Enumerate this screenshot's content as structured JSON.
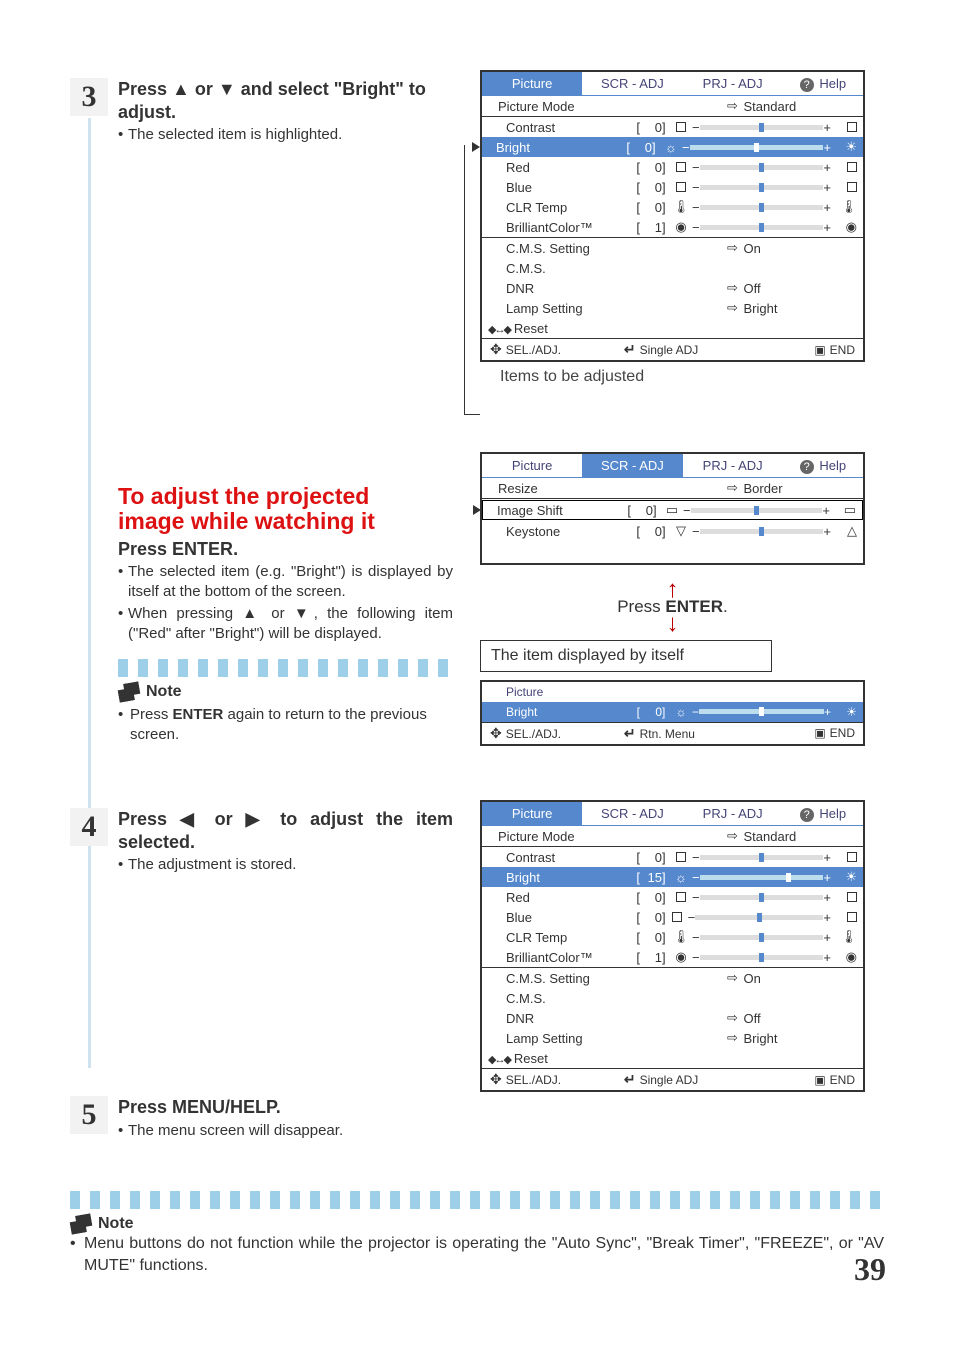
{
  "page_number": "39",
  "steps": {
    "s3": {
      "num": "3",
      "instr_a": "Press ",
      "instr_b": " or ",
      "instr_c": " and select \"Bright\" to adjust.",
      "bullet1": "The selected item is highlighted."
    },
    "adjust_section": {
      "title_l1": "To adjust the projected",
      "title_l2": "image while watching it",
      "press": "Press ",
      "press_btn": "ENTER",
      "press_dot": ".",
      "bullet1": "The selected item (e.g. \"Bright\") is dis­played by itself at the bottom of the screen.",
      "bullet2a": "When pressing ",
      "bullet2b": " or ",
      "bullet2c": ", the following item (\"Red\" after \"Bright\") will be displayed."
    },
    "note1": {
      "head": "Note",
      "text_a": "Press ",
      "text_b": "ENTER",
      "text_c": " again to return to the pre­vious screen."
    },
    "s4": {
      "num": "4",
      "instr_a": "Press ",
      "instr_b": " or ",
      "instr_c": " to adjust the item selected.",
      "bullet1": "The adjustment is stored."
    },
    "s5": {
      "num": "5",
      "instr_a": "Press ",
      "instr_b": "MENU/HELP",
      "instr_c": ".",
      "bullet1": "The menu screen will disappear."
    }
  },
  "osd_common": {
    "tab_picture": "Picture",
    "tab_scr": "SCR - ADJ",
    "tab_prj": "PRJ - ADJ",
    "tab_help": "Help",
    "picture_mode": "Picture Mode",
    "standard": "Standard",
    "contrast": "Contrast",
    "bright": "Bright",
    "red": "Red",
    "blue": "Blue",
    "clr_temp": "CLR Temp",
    "brilliant": "BrilliantColor™",
    "cms_setting": "C.M.S. Setting",
    "cms": "C.M.S.",
    "dnr": "DNR",
    "lamp": "Lamp Setting",
    "on": "On",
    "off": "Off",
    "bright_val": "Bright",
    "reset": "Reset",
    "seladj": "SEL./ADJ.",
    "single": "Single ADJ",
    "rtn": "Rtn. Menu",
    "end": "END",
    "val0": "0",
    "val1": "1",
    "val15": "15",
    "resize": "Resize",
    "imgshift": "Image Shift",
    "keystone": "Keystone",
    "border": "Border"
  },
  "captions": {
    "items_adjusted": "Items to be adjusted",
    "press_enter": "Press ",
    "press_enter_b": "ENTER",
    "press_enter_dot": ".",
    "item_displayed": "The item displayed by itself"
  },
  "note_bottom": {
    "head": "Note",
    "text": "Menu buttons do not function while the projector is operating the \"Auto Sync\", \"Break Timer\", \"FREEZE\", or \"AV MUTE\" functions."
  }
}
